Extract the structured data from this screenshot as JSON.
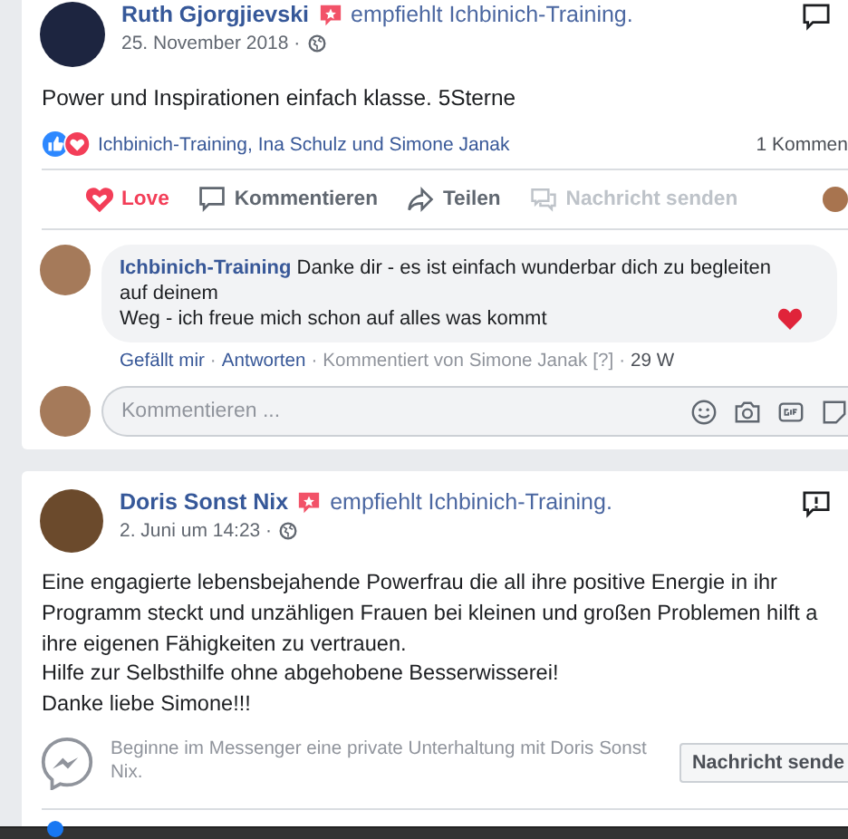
{
  "posts": [
    {
      "author": "Ruth Gjorgjievski",
      "action": "empfiehlt Ichbinich-Training.",
      "date": "25. November 2018 ·",
      "text": "Power und Inspirationen einfach klasse. 5Sterne",
      "reactions": {
        "names": "Ichbinich-Training, Ina Schulz und Simone Janak",
        "count": "1 Kommen"
      },
      "actions": [
        {
          "label": "Love",
          "kind": "reaction",
          "active": true,
          "disabled": false
        },
        {
          "label": "Kommentieren",
          "kind": "comment",
          "active": false,
          "disabled": false
        },
        {
          "label": "Teilen",
          "kind": "share",
          "active": false,
          "disabled": false
        },
        {
          "label": "Nachricht senden",
          "kind": "message",
          "active": false,
          "disabled": true
        }
      ],
      "comment": {
        "author": "Ichbinich-Training",
        "text": "Danke dir - es ist einfach wunderbar dich zu begleiten\nauf deinem\nWeg - ich freue mich schon auf alles was kommt",
        "links": [
          "Gefällt mir",
          "Antworten"
        ],
        "separator": "·",
        "note": "Kommentiert von Simone Janak",
        "help": "[?]",
        "age": "29 W"
      },
      "comment_input": {
        "placeholder": "Kommentieren ..."
      }
    },
    {
      "author": "Doris Sonst Nix",
      "action": "empfiehlt Ichbinich-Training.",
      "date": "2. Juni um 14:23 ·",
      "text": "Eine engagierte lebensbejahende Powerfrau die all ihre positive Energie in ihr\nProgramm steckt und unzähligen Frauen bei kleinen und großen Problemen hilft a\nihre eigenen Fähigkeiten zu vertrauen.\nHilfe zur Selbsthilfe ohne abgehobene Besserwisserei!\nDanke liebe Simone!!!",
      "messenger": {
        "text": "Beginne im Messenger eine private Unterhaltung mit Doris Sonst Nix.",
        "button": "Nachricht sende"
      }
    }
  ]
}
